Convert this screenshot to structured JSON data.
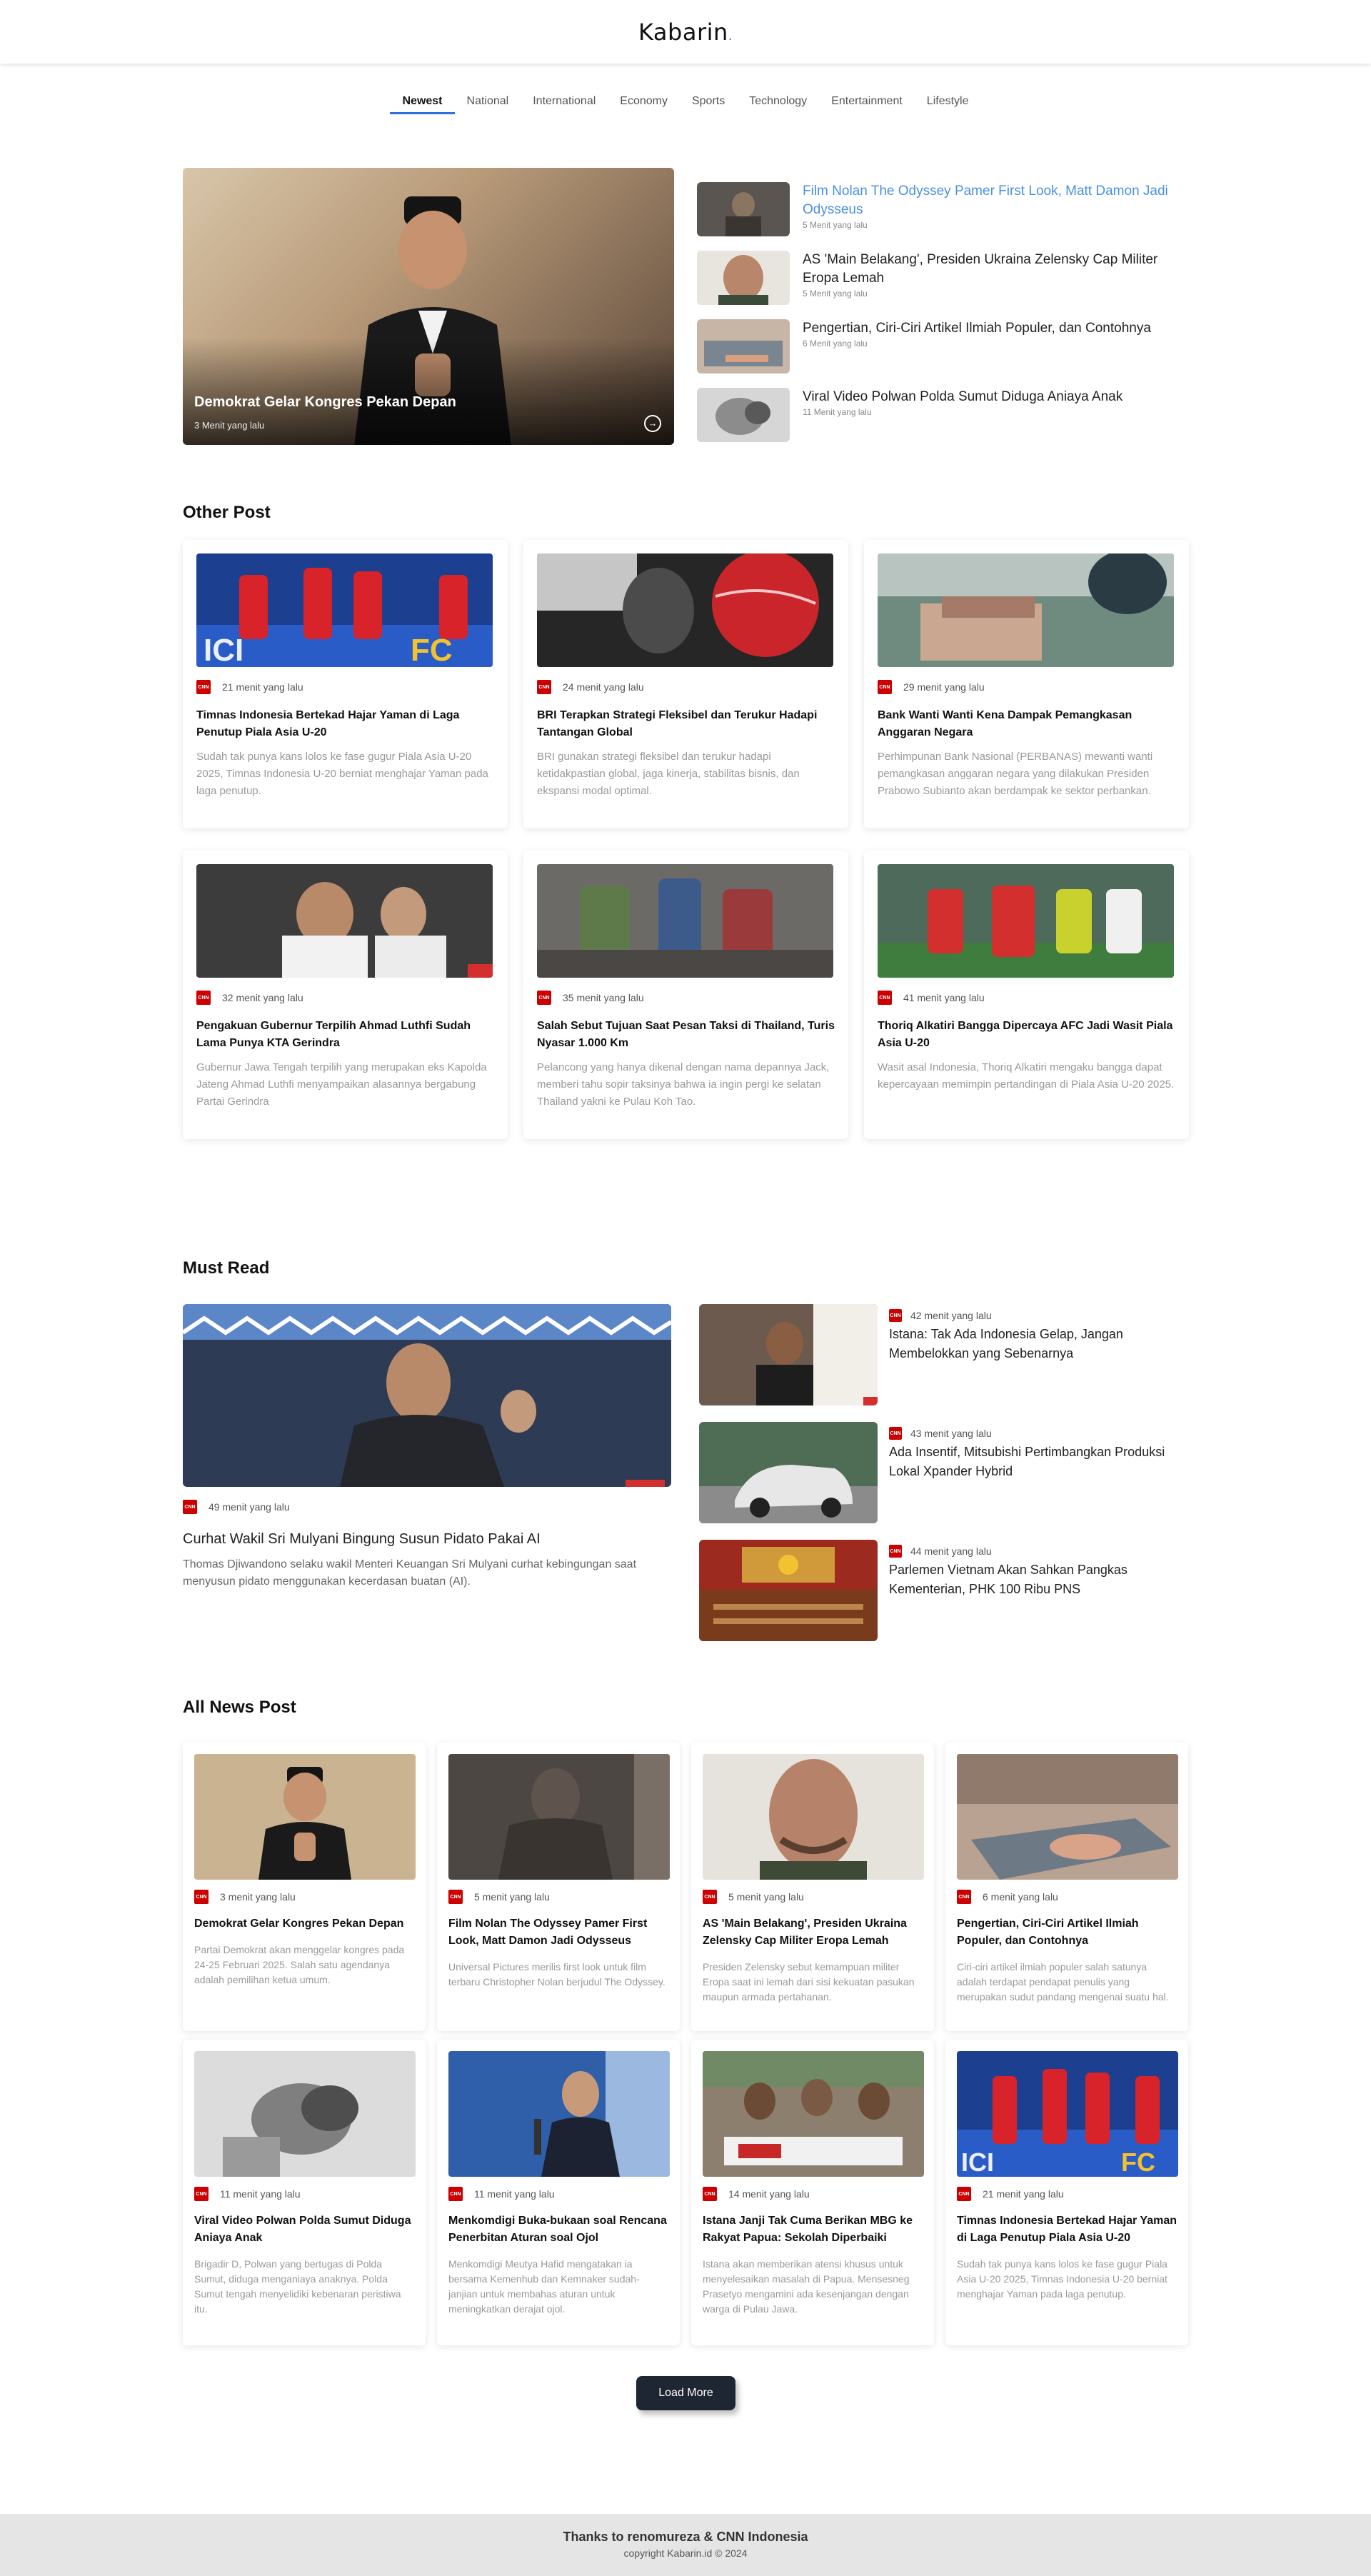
{
  "header": {
    "logo": "Kabarin",
    "logo_dot": "."
  },
  "nav": [
    {
      "label": "Newest",
      "active": true
    },
    {
      "label": "National"
    },
    {
      "label": "International"
    },
    {
      "label": "Economy"
    },
    {
      "label": "Sports"
    },
    {
      "label": "Technology"
    },
    {
      "label": "Entertainment"
    },
    {
      "label": "Lifestyle"
    }
  ],
  "hero": {
    "main": {
      "title": "Demokrat Gelar Kongres Pekan Depan",
      "time": "3 Menit yang lalu"
    },
    "list": [
      {
        "title": "Film Nolan The Odyssey Pamer First Look, Matt Damon Jadi Odysseus",
        "time": "5 Menit yang lalu"
      },
      {
        "title": "AS 'Main Belakang', Presiden Ukraina Zelensky Cap Militer Eropa Lemah",
        "time": "5 Menit yang lalu"
      },
      {
        "title": "Pengertian, Ciri-Ciri Artikel Ilmiah Populer, dan Contohnya",
        "time": "6 Menit yang lalu"
      },
      {
        "title": "Viral Video Polwan Polda Sumut Diduga Aniaya Anak",
        "time": "11 Menit yang lalu"
      }
    ]
  },
  "other_post": {
    "title": "Other Post",
    "badge": "CNN",
    "cards": [
      {
        "time": "21 menit yang lalu",
        "title": "Timnas Indonesia Bertekad Hajar Yaman di Laga Penutup Piala Asia U-20",
        "desc": "Sudah tak punya kans lolos ke fase gugur Piala Asia U-20 2025, Timnas Indonesia U-20 berniat menghajar Yaman pada laga penutup."
      },
      {
        "time": "24 menit yang lalu",
        "title": "BRI Terapkan Strategi Fleksibel dan Terukur Hadapi Tantangan Global",
        "desc": "BRI gunakan strategi fleksibel dan terukur hadapi ketidakpastian global, jaga kinerja, stabilitas bisnis, dan ekspansi modal optimal."
      },
      {
        "time": "29 menit yang lalu",
        "title": "Bank Wanti Wanti Kena Dampak Pemangkasan Anggaran Negara",
        "desc": "Perhimpunan Bank Nasional (PERBANAS) mewanti wanti pemangkasan anggaran negara yang dilakukan Presiden Prabowo Subianto akan berdampak ke sektor perbankan."
      },
      {
        "time": "32 menit yang lalu",
        "title": "Pengakuan Gubernur Terpilih Ahmad Luthfi Sudah Lama Punya KTA Gerindra",
        "desc": "Gubernur Jawa Tengah terpilih yang merupakan eks Kapolda Jateng Ahmad Luthfi menyampaikan alasannya bergabung Partai Gerindra"
      },
      {
        "time": "35 menit yang lalu",
        "title": "Salah Sebut Tujuan Saat Pesan Taksi di Thailand, Turis Nyasar 1.000 Km",
        "desc": "Pelancong yang hanya dikenal dengan nama depannya Jack, memberi tahu sopir taksinya bahwa ia ingin pergi ke selatan Thailand yakni ke Pulau Koh Tao."
      },
      {
        "time": "41 menit yang lalu",
        "title": "Thoriq Alkatiri Bangga Dipercaya AFC Jadi Wasit Piala Asia U-20",
        "desc": "Wasit asal Indonesia, Thoriq Alkatiri mengaku bangga dapat kepercayaan memimpin pertandingan di Piala Asia U-20 2025."
      }
    ]
  },
  "must_read": {
    "title": "Must Read",
    "main": {
      "time": "49 menit yang lalu",
      "title": "Curhat Wakil Sri Mulyani Bingung Susun Pidato Pakai AI",
      "desc": "Thomas Djiwandono selaku wakil Menteri Keuangan Sri Mulyani curhat kebingungan saat menyusun pidato menggunakan kecerdasan buatan (AI)."
    },
    "items": [
      {
        "time": "42 menit yang lalu",
        "title": "Istana: Tak Ada Indonesia Gelap, Jangan Membelokkan yang Sebenarnya"
      },
      {
        "time": "43 menit yang lalu",
        "title": "Ada Insentif, Mitsubishi Pertimbangkan Produksi Lokal Xpander Hybrid"
      },
      {
        "time": "44 menit yang lalu",
        "title": "Parlemen Vietnam Akan Sahkan Pangkas Kementerian, PHK 100 Ribu PNS"
      }
    ]
  },
  "all_news": {
    "title": "All News Post",
    "cards": [
      {
        "time": "3 menit yang lalu",
        "title": "Demokrat Gelar Kongres Pekan Depan",
        "desc": "Partai Demokrat akan menggelar kongres pada 24-25 Februari 2025. Salah satu agendanya adalah pemilihan ketua umum."
      },
      {
        "time": "5 menit yang lalu",
        "title": "Film Nolan The Odyssey Pamer First Look, Matt Damon Jadi Odysseus",
        "desc": "Universal Pictures merilis first look untuk film terbaru Christopher Nolan berjudul The Odyssey."
      },
      {
        "time": "5 menit yang lalu",
        "title": "AS 'Main Belakang', Presiden Ukraina Zelensky Cap Militer Eropa Lemah",
        "desc": "Presiden Zelensky sebut kemampuan militer Eropa saat ini lemah dari sisi kekuatan pasukan maupun armada pertahanan."
      },
      {
        "time": "6 menit yang lalu",
        "title": "Pengertian, Ciri-Ciri Artikel Ilmiah Populer, dan Contohnya",
        "desc": "Ciri-ciri artikel ilmiah populer salah satunya adalah terdapat pendapat penulis yang merupakan sudut pandang mengenai suatu hal."
      },
      {
        "time": "11 menit yang lalu",
        "title": "Viral Video Polwan Polda Sumut Diduga Aniaya Anak",
        "desc": "Brigadir D, Polwan yang bertugas di Polda Sumut, diduga menganiaya anaknya. Polda Sumut tengah menyelidiki kebenaran peristiwa itu."
      },
      {
        "time": "11 menit yang lalu",
        "title": "Menkomdigi Buka-bukaan soal Rencana Penerbitan Aturan soal Ojol",
        "desc": "Menkomdigi Meutya Hafid mengatakan ia bersama Kemenhub dan Kemnaker sudah-janjian untuk membahas aturan untuk meningkatkan derajat ojol."
      },
      {
        "time": "14 menit yang lalu",
        "title": "Istana Janji Tak Cuma Berikan MBG ke Rakyat Papua: Sekolah Diperbaiki",
        "desc": "Istana akan memberikan atensi khusus untuk menyelesaikan masalah di Papua. Mensesneg Prasetyo mengamini ada kesenjangan dengan warga di Pulau Jawa."
      },
      {
        "time": "21 menit yang lalu",
        "title": "Timnas Indonesia Bertekad Hajar Yaman di Laga Penutup Piala Asia U-20",
        "desc": "Sudah tak punya kans lolos ke fase gugur Piala Asia U-20 2025, Timnas Indonesia U-20 berniat menghajar Yaman pada laga penutup."
      }
    ],
    "load_more": "Load More"
  },
  "footer": {
    "thanks": "Thanks to renomureza & CNN Indonesia",
    "copyright": "copyright Kabarin.id © 2024"
  }
}
